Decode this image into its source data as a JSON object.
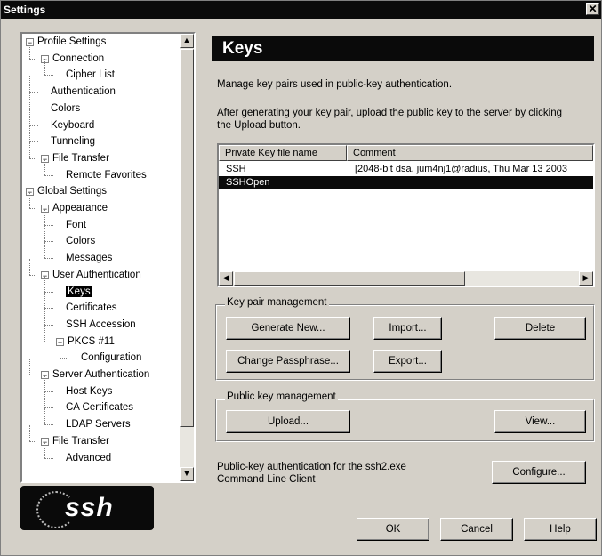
{
  "window": {
    "title": "Settings",
    "close_glyph": "✕"
  },
  "tree": {
    "nodes": [
      {
        "label": "Profile Settings",
        "exp": "-"
      },
      {
        "label": "Connection",
        "exp": "-"
      },
      {
        "label": "Cipher List"
      },
      {
        "label": "Authentication"
      },
      {
        "label": "Colors"
      },
      {
        "label": "Keyboard"
      },
      {
        "label": "Tunneling"
      },
      {
        "label": "File Transfer",
        "exp": "-"
      },
      {
        "label": "Remote Favorites"
      },
      {
        "label": "Global Settings",
        "exp": "-"
      },
      {
        "label": "Appearance",
        "exp": "-"
      },
      {
        "label": "Font"
      },
      {
        "label": "Colors"
      },
      {
        "label": "Messages"
      },
      {
        "label": "User Authentication",
        "exp": "-"
      },
      {
        "label": "Keys",
        "selected": true
      },
      {
        "label": "Certificates"
      },
      {
        "label": "SSH Accession"
      },
      {
        "label": "PKCS #11",
        "exp": "-"
      },
      {
        "label": "Configuration"
      },
      {
        "label": "Server Authentication",
        "exp": "-"
      },
      {
        "label": "Host Keys"
      },
      {
        "label": "CA Certificates"
      },
      {
        "label": "LDAP Servers"
      },
      {
        "label": "File Transfer",
        "exp": "-"
      },
      {
        "label": "Advanced"
      }
    ]
  },
  "logo": {
    "text": "ssh"
  },
  "panel": {
    "title": "Keys",
    "description": "Manage key pairs used in public-key authentication.",
    "instructions_line1": "After generating your key pair, upload the public key to the server by clicking",
    "instructions_line2": "the Upload button."
  },
  "key_list": {
    "columns": [
      "Private Key file name",
      "Comment"
    ],
    "rows": [
      {
        "name": "SSH",
        "comment": "[2048-bit dsa, jum4nj1@radius, Thu Mar 13 2003"
      },
      {
        "name": "SSHOpen",
        "comment": "",
        "selected": true
      }
    ]
  },
  "key_pair_management": {
    "legend": "Key pair management",
    "generate_new": "Generate New...",
    "import": "Import...",
    "delete": "Delete",
    "change_passphrase": "Change Passphrase...",
    "export": "Export..."
  },
  "public_key_management": {
    "legend": "Public key management",
    "upload": "Upload...",
    "view": "View..."
  },
  "ssh2": {
    "line1": "Public-key authentication for the ssh2.exe",
    "line2": "Command Line Client",
    "configure": "Configure..."
  },
  "footer": {
    "ok": "OK",
    "cancel": "Cancel",
    "help": "Help"
  },
  "colors": {
    "title_bg": "#0a0a0a",
    "dialog_bg": "#d4d0c8",
    "selection": "#0a0a0a"
  }
}
